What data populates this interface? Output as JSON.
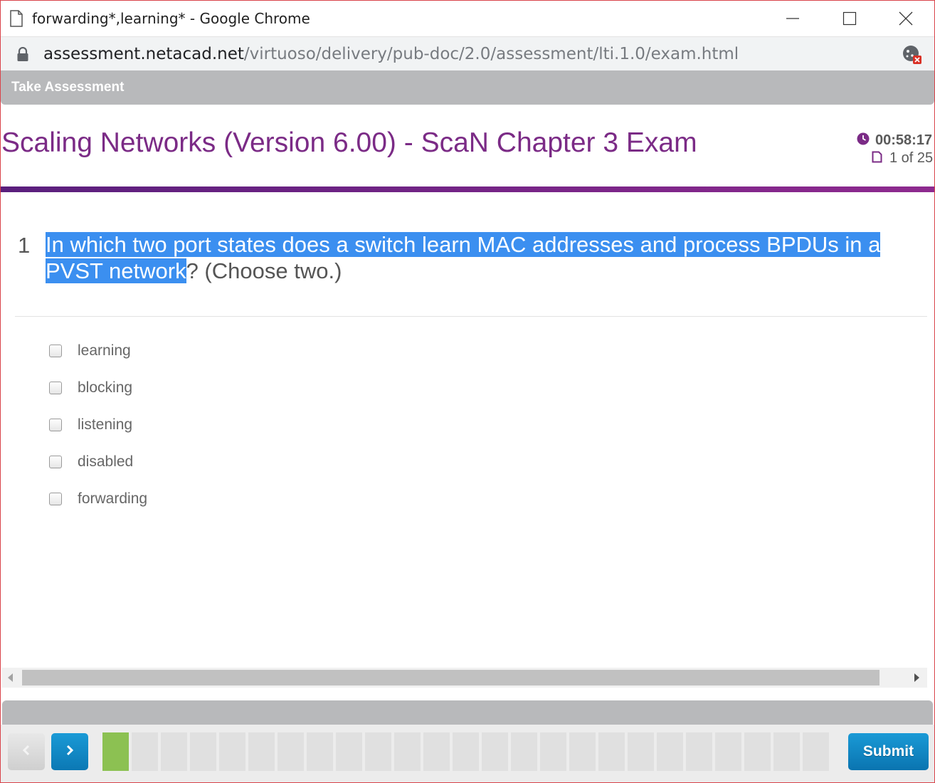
{
  "window": {
    "title": "forwarding*,learning* - Google Chrome"
  },
  "address_bar": {
    "host": "assessment.netacad.net",
    "path": "/virtuoso/delivery/pub-doc/2.0/assessment/lti.1.0/exam.html"
  },
  "banner": {
    "label": "Take Assessment"
  },
  "exam": {
    "title": "Scaling Networks (Version 6.00) - ScaN Chapter 3 Exam",
    "timer": "00:58:17",
    "progress": "1 of 25"
  },
  "question": {
    "number": "1",
    "selected_text": "In which two port states does a switch learn MAC addresses and process BPDUs in a PVST network",
    "rest_text": "? (Choose two.)",
    "options": [
      {
        "label": "learning",
        "checked": false
      },
      {
        "label": "blocking",
        "checked": false
      },
      {
        "label": "listening",
        "checked": false
      },
      {
        "label": "disabled",
        "checked": false
      },
      {
        "label": "forwarding",
        "checked": false
      }
    ]
  },
  "footer": {
    "submit_label": "Submit",
    "question_boxes": {
      "total": 25,
      "answered": [
        1
      ]
    }
  },
  "colors": {
    "title_purple": "#7b2b86",
    "selection_blue": "#3b8ff0",
    "answered_green": "#8cc152",
    "nav_blue": "#0b78b4"
  }
}
